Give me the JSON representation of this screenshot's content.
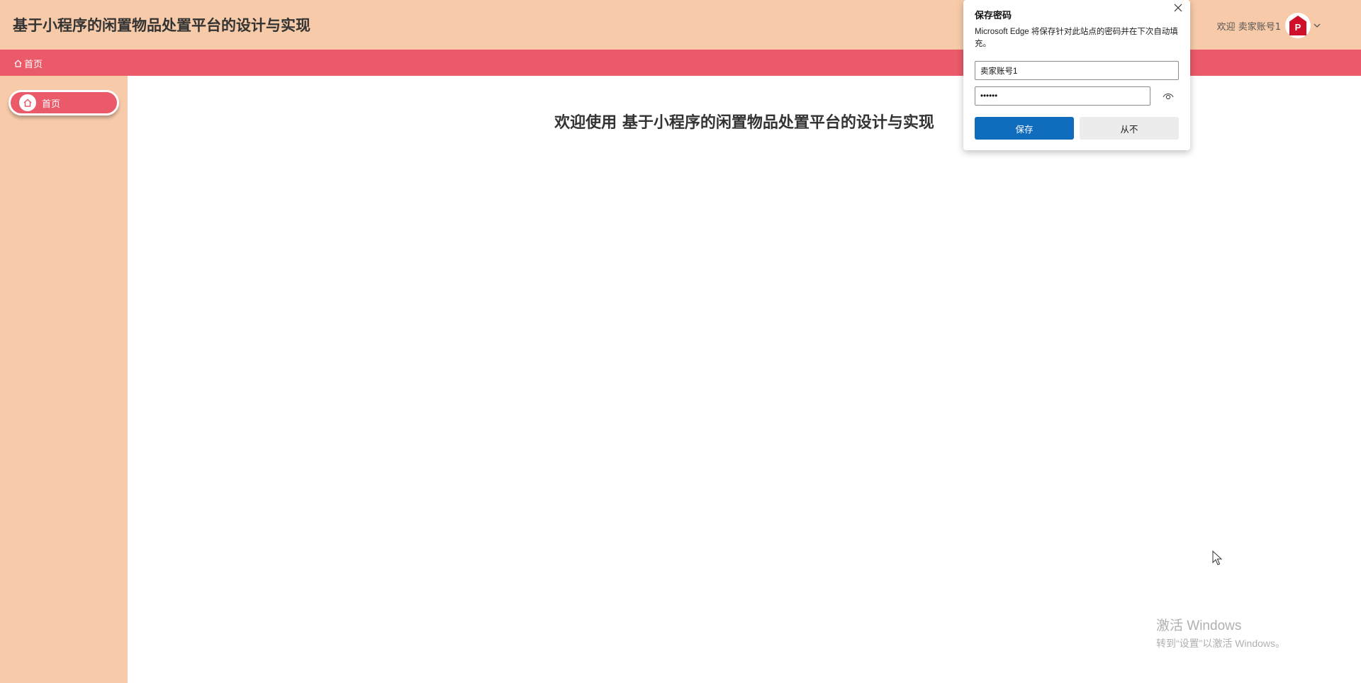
{
  "header": {
    "app_title": "基于小程序的闲置物品处置平台的设计与实现",
    "welcome_text": "欢迎 卖家账号1",
    "avatar_icon": "avatar-logo-icon",
    "dropdown_icon": "chevron-down-icon"
  },
  "navbar": {
    "breadcrumb_icon": "home-icon",
    "breadcrumb_label": "首页"
  },
  "sidebar": {
    "items": [
      {
        "label": "首页",
        "icon": "home-icon",
        "active": true
      }
    ]
  },
  "main": {
    "welcome_heading": "欢迎使用 基于小程序的闲置物品处置平台的设计与实现"
  },
  "password_dialog": {
    "title": "保存密码",
    "description": "Microsoft Edge 将保存针对此站点的密码并在下次自动填充。",
    "username_value": "卖家账号1",
    "password_value": "••••••",
    "save_label": "保存",
    "never_label": "从不",
    "close_icon": "close-icon",
    "show_password_icon": "eye-icon"
  },
  "watermark": {
    "title": "激活 Windows",
    "subtitle": "转到“设置”以激活 Windows。"
  },
  "colors": {
    "header_bg": "#f7cba9",
    "navbar_bg": "#ea5a69",
    "sidebar_bg": "#f7cba9",
    "menu_active_bg": "#ea5a69",
    "primary_button": "#0f6cbd"
  }
}
